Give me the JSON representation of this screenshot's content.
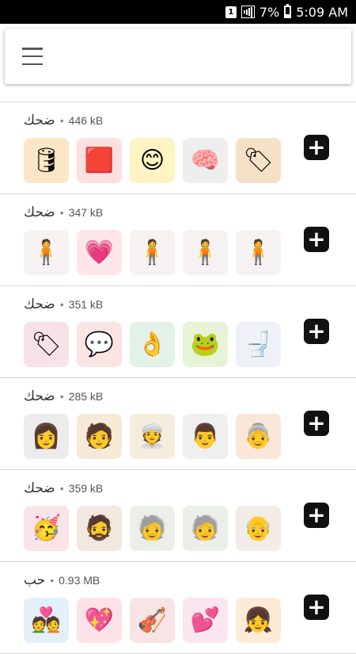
{
  "status_bar": {
    "sim_badge": "1",
    "battery": "7%",
    "time": "5:09 AM"
  },
  "toolbar": {
    "menu_icon": "hamburger-icon"
  },
  "packs": [
    {
      "name": "ضحك",
      "size": "446 kB",
      "stickers": [
        {
          "glyph": "🛢",
          "color": "#fbe7c6"
        },
        {
          "glyph": "🟥",
          "color": "#fde0e0"
        },
        {
          "glyph": "😊",
          "color": "#fff4c2"
        },
        {
          "glyph": "🧠",
          "color": "#eeeeee"
        },
        {
          "glyph": "🏷",
          "color": "#f5e1c8"
        }
      ]
    },
    {
      "name": "ضحك",
      "size": "347 kB",
      "stickers": [
        {
          "glyph": "🧍",
          "color": "#f7f2f2"
        },
        {
          "glyph": "💗",
          "color": "#fde6ea"
        },
        {
          "glyph": "🧍",
          "color": "#f7f2f2"
        },
        {
          "glyph": "🧍",
          "color": "#f7f2f2"
        },
        {
          "glyph": "🧍",
          "color": "#f7f2f2"
        }
      ]
    },
    {
      "name": "ضحك",
      "size": "351 kB",
      "stickers": [
        {
          "glyph": "🏷",
          "color": "#f8e2e8"
        },
        {
          "glyph": "💬",
          "color": "#fbe4e4"
        },
        {
          "glyph": "👌",
          "color": "#e3f2e6"
        },
        {
          "glyph": "🐸",
          "color": "#e6f3d8"
        },
        {
          "glyph": "🚽",
          "color": "#eef2f6"
        }
      ]
    },
    {
      "name": "ضحك",
      "size": "285 kB",
      "stickers": [
        {
          "glyph": "👩",
          "color": "#ececec"
        },
        {
          "glyph": "🧑",
          "color": "#f6e9d8"
        },
        {
          "glyph": "👳",
          "color": "#f6ecdc"
        },
        {
          "glyph": "👨",
          "color": "#efefef"
        },
        {
          "glyph": "👵",
          "color": "#fbe7da"
        }
      ]
    },
    {
      "name": "ضحك",
      "size": "359 kB",
      "stickers": [
        {
          "glyph": "🥳",
          "color": "#fbe3ea"
        },
        {
          "glyph": "🧔",
          "color": "#f1e8df"
        },
        {
          "glyph": "🧓",
          "color": "#ecefe9"
        },
        {
          "glyph": "🧓",
          "color": "#ecefe9"
        },
        {
          "glyph": "👴",
          "color": "#f1ede6"
        }
      ]
    },
    {
      "name": "حب",
      "size": "0.93 MB",
      "stickers": [
        {
          "glyph": "💑",
          "color": "#e3f0fa"
        },
        {
          "glyph": "💖",
          "color": "#fde2e8"
        },
        {
          "glyph": "🎻",
          "color": "#f8e4e4"
        },
        {
          "glyph": "💕",
          "color": "#fbe5ee"
        },
        {
          "glyph": "👧",
          "color": "#fdebd8"
        }
      ]
    }
  ],
  "add_label": "+"
}
